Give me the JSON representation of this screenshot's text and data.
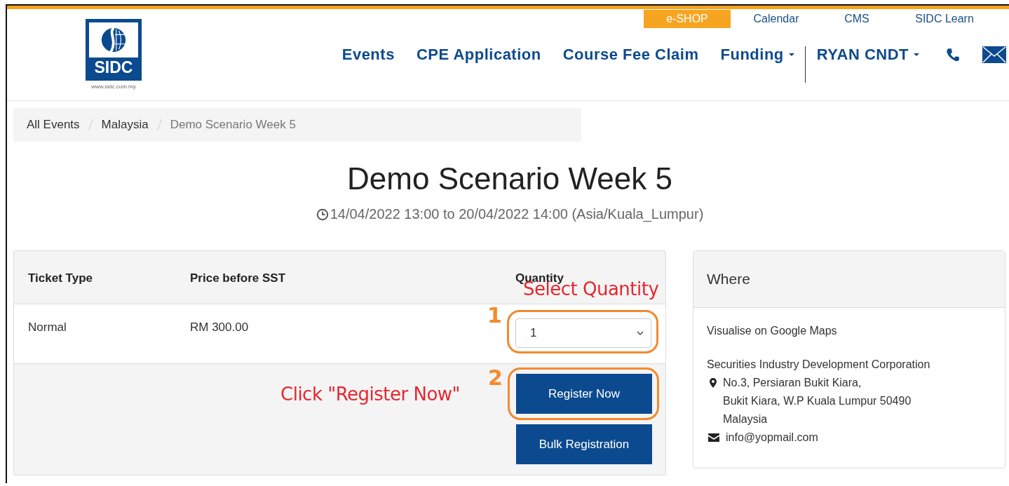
{
  "top_links": [
    {
      "label": "e-SHOP",
      "highlighted": true
    },
    {
      "label": "Calendar",
      "highlighted": false
    },
    {
      "label": "CMS",
      "highlighted": false
    },
    {
      "label": "SIDC Learn",
      "highlighted": false
    }
  ],
  "logo": {
    "text": "SIDC",
    "url": "www.sidc.com.my"
  },
  "nav": [
    {
      "label": "Events",
      "dropdown": false
    },
    {
      "label": "CPE Application",
      "dropdown": false
    },
    {
      "label": "Course Fee Claim",
      "dropdown": false
    },
    {
      "label": "Funding",
      "dropdown": true
    },
    {
      "label": "RYAN CNDT",
      "dropdown": true
    }
  ],
  "breadcrumb": [
    "All Events",
    "Malaysia",
    "Demo Scenario Week 5"
  ],
  "title": "Demo Scenario Week 5",
  "date_range": "14/04/2022 13:00 to 20/04/2022 14:00 (Asia/Kuala_Lumpur)",
  "tickets": {
    "columns": [
      "Ticket Type",
      "Price before SST",
      "Quantity"
    ],
    "rows": [
      {
        "type": "Normal",
        "price": "RM 300.00",
        "quantity": "1"
      }
    ],
    "buttons": [
      "Register Now",
      "Bulk Registration"
    ]
  },
  "annotations": {
    "select_hint": "Select Quantity",
    "step_1": "1",
    "step_2": "2",
    "register_hint": "Click \"Register Now\""
  },
  "where": {
    "title": "Where",
    "map_link": "Visualise on Google Maps",
    "organisation": "Securities Industry Development Corporation",
    "address": [
      "No.3, Persiaran Bukit Kiara,",
      "Bukit Kiara, W.P Kuala Lumpur 50490",
      "Malaysia"
    ],
    "email": "info@yopmail.com"
  }
}
